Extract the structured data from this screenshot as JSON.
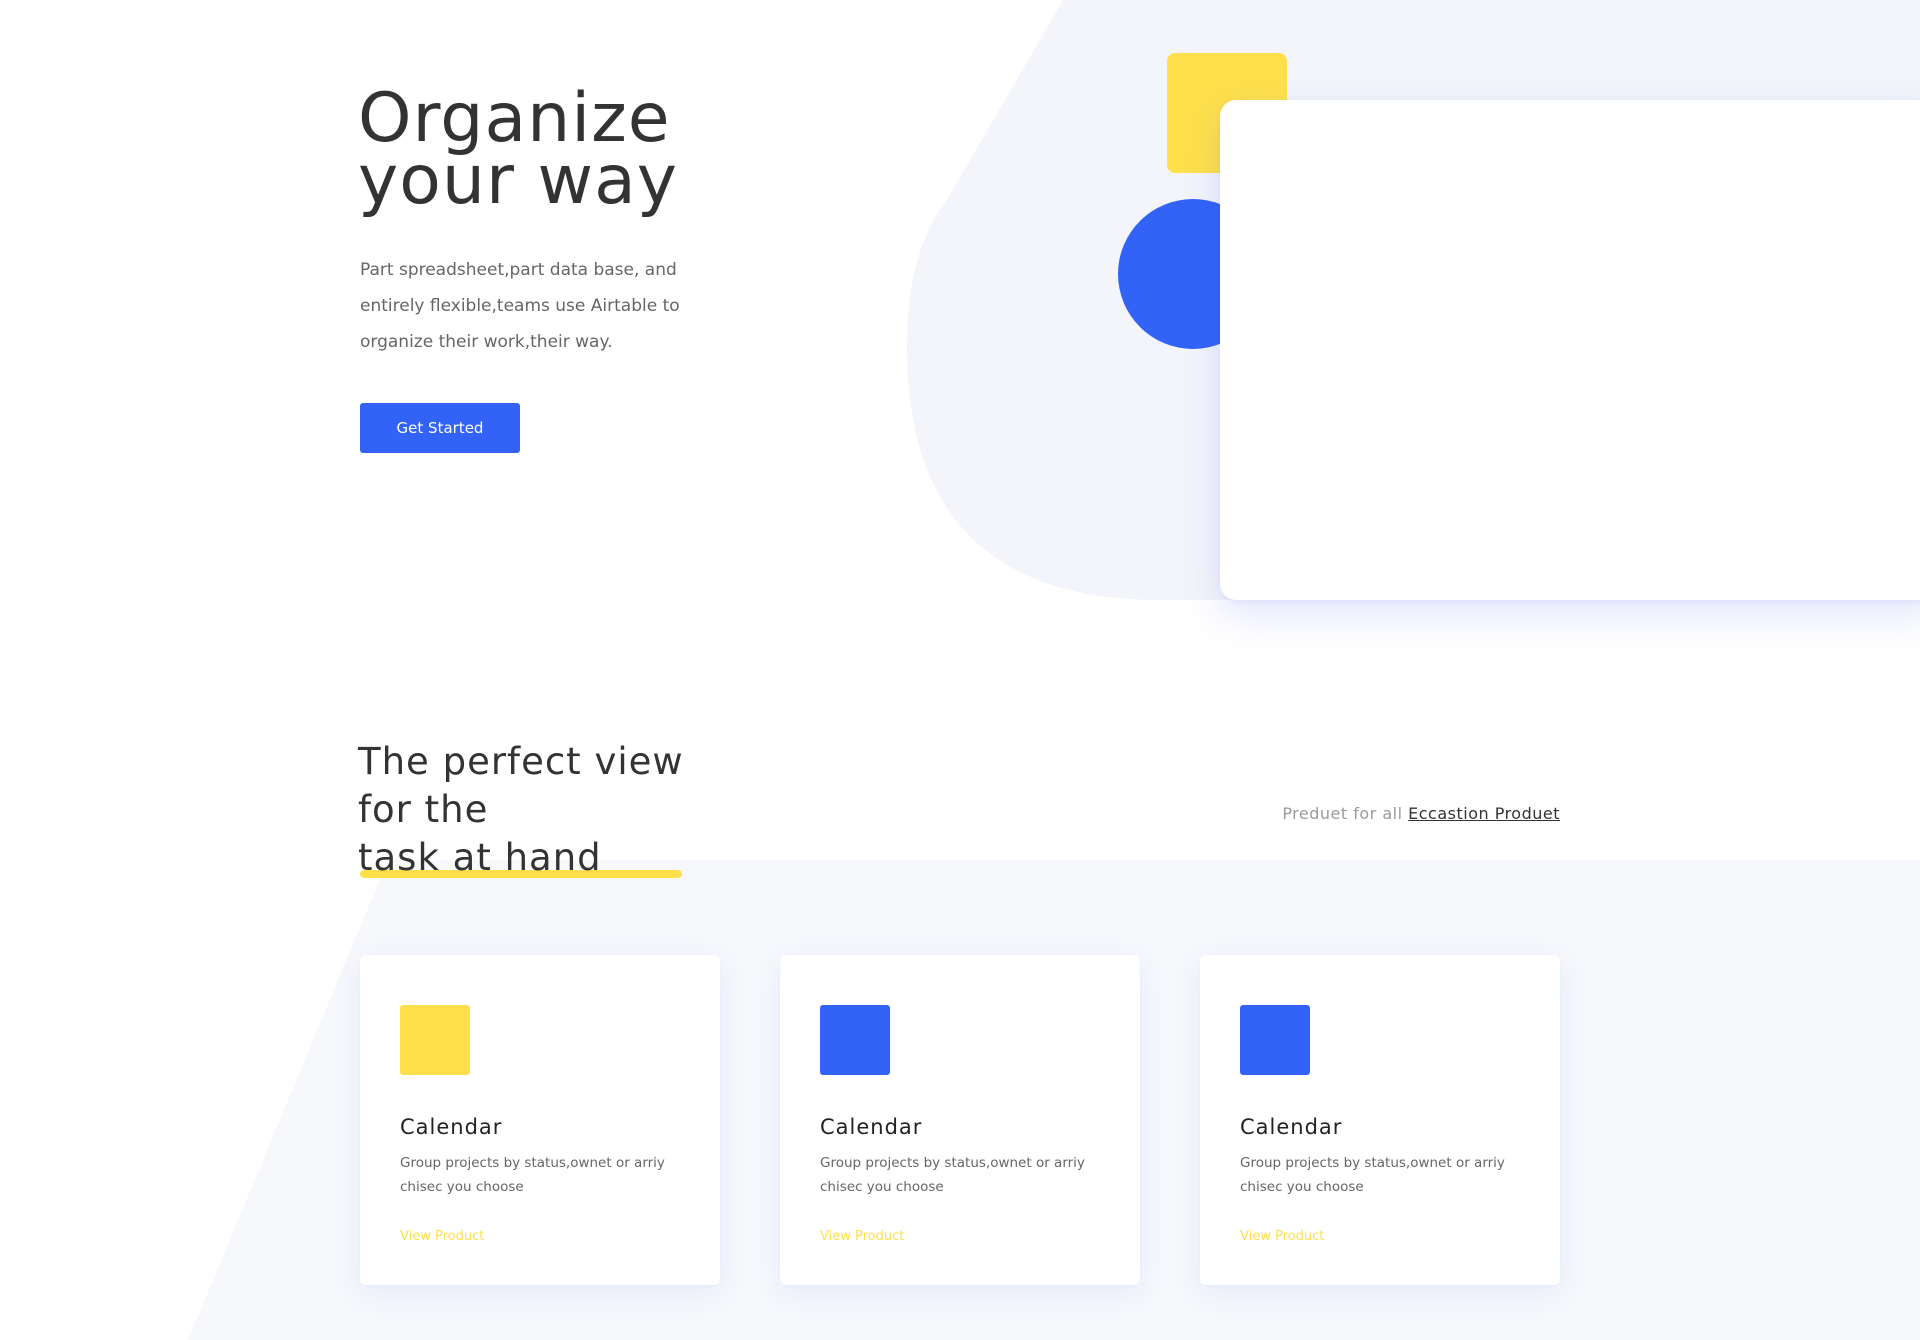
{
  "colors": {
    "accent_blue": "#3263f6",
    "accent_yellow": "#ffe04b",
    "background_shape": "#f3f5fa",
    "text_dark": "#333333",
    "text_muted": "#666666"
  },
  "hero": {
    "title_lines": [
      "Organize",
      "your way"
    ],
    "description_lines": [
      "Part spreadsheet,part data base, and",
      "entirely flexible,teams use Airtable to",
      "organize their work,their way."
    ],
    "cta_label": "Get Started"
  },
  "views_section": {
    "title_line1": "The perfect view",
    "title_line2_prefix": "for the ",
    "title_line2_highlight": "task at hand",
    "link_prefix": "Preduet for all ",
    "link_text": "Eccastion Produet"
  },
  "cards": [
    {
      "icon_color": "#ffe04b",
      "title": "Calendar",
      "description_lines": [
        "Group projects by status,ownet or arriy",
        "chisec you choose"
      ],
      "link": "View Product"
    },
    {
      "icon_color": "#3263f6",
      "title": "Calendar",
      "description_lines": [
        "Group projects by status,ownet or arriy",
        "chisec you choose"
      ],
      "link": "View Product"
    },
    {
      "icon_color": "#3263f6",
      "title": "Calendar",
      "description_lines": [
        "Group projects by status,ownet or arriy",
        "chisec you choose"
      ],
      "link": "View Product"
    }
  ]
}
